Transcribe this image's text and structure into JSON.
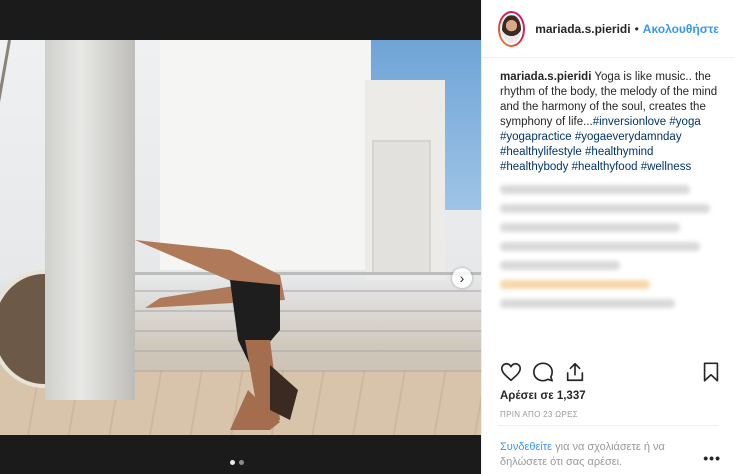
{
  "post": {
    "username": "mariada.s.pieridi",
    "separator": "•",
    "follow_label": "Ακολουθήστε",
    "caption_text": "Yoga is like music.. the rhythm of the body, the melody of the mind and the harmony of the soul, creates the symphony of life...",
    "hashtags": [
      "#inversionlove",
      "#yoga",
      "#yogapractice",
      "#yogaeverydamnday",
      "#healthylifestyle",
      "#healthymind",
      "#healthybody",
      "#healthyfood",
      "#wellness"
    ],
    "likes_text": "Αρέσει σε 1,337",
    "time_text": "ΠΡΙΝ ΑΠΟ 23 ΩΡΕΣ",
    "login_link": "Συνδεθείτε",
    "login_text": " για να σχολιάσετε ή να δηλώσετε ότι σας αρέσει.",
    "more_label": "•••",
    "next_arrow": "›"
  },
  "icons": {
    "avatar": "avatar-image",
    "like": "heart-icon",
    "comment": "comment-icon",
    "share": "share-icon",
    "save": "bookmark-icon",
    "next": "chevron-right-icon"
  },
  "colors": {
    "link_blue": "#3897f0",
    "hashtag_blue": "#003569",
    "text_dark": "#262626",
    "muted": "#999999"
  }
}
